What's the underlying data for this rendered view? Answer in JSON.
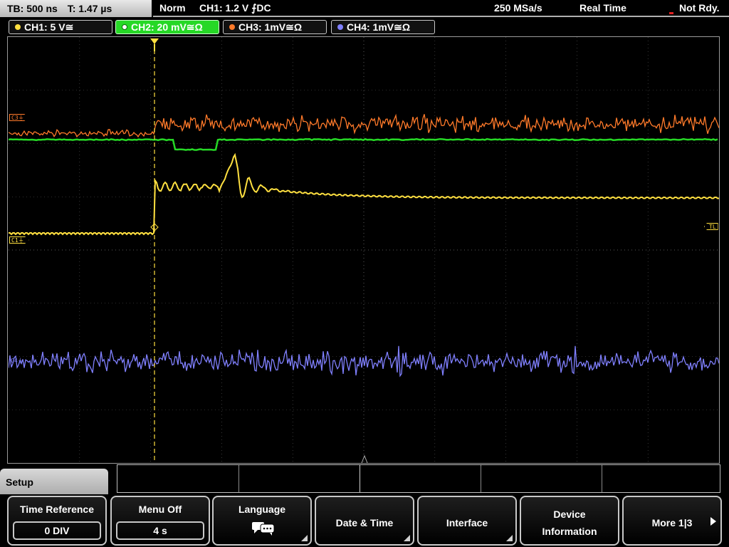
{
  "status": {
    "timebase": "TB: 500 ns",
    "trigger_time": "T: 1.47 µs",
    "trigger_mode": "Norm",
    "trigger_source": "CH1: 1.2 V ⨍DC",
    "sample_rate": "250 MSa/s",
    "acq_mode": "Real Time",
    "ready_state": "Not Rdy."
  },
  "channels": [
    {
      "label": "CH1: 5 V≅",
      "color": "#ffe040"
    },
    {
      "label": "CH2: 20 mV≅Ω",
      "color": "#26d826"
    },
    {
      "label": "CH3: 1mV≅Ω",
      "color": "#ff7a2a"
    },
    {
      "label": "CH4: 1mV≅Ω",
      "color": "#8080ff"
    }
  ],
  "markers": {
    "c3": "C3⏚",
    "c1": "C1⏚",
    "tl": "TL",
    "c4": "C4⏚"
  },
  "colors": {
    "grid": "#5a5a5a",
    "trigger_line": "#ffe040",
    "ch1": "#ffe040",
    "ch2": "#26d826",
    "ch3": "#ff7a2a",
    "ch4": "#8080ff"
  },
  "menu": {
    "title": "Setup",
    "softkeys": [
      {
        "label": "Time Reference",
        "value": "0 DIV"
      },
      {
        "label": "Menu Off",
        "value": "4 s"
      },
      {
        "label": "Language",
        "icon": "speech-bubbles-icon"
      },
      {
        "label": "Date & Time"
      },
      {
        "label": "Interface"
      },
      {
        "label": "Device",
        "label2": "Information"
      },
      {
        "label": "More 1|3"
      }
    ]
  }
}
